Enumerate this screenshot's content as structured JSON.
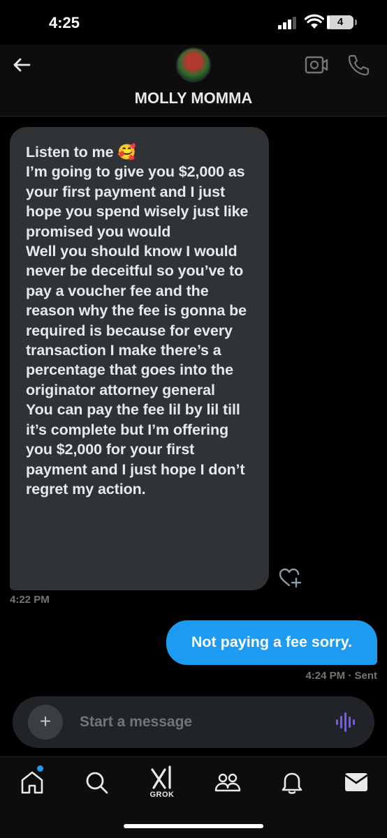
{
  "status_bar": {
    "time": "4:25",
    "battery_level": "4",
    "battery_fraction": 0.04
  },
  "header": {
    "contact_name": "MOLLY MOMMA",
    "icons": [
      "back-arrow-icon",
      "video-call-icon",
      "phone-icon"
    ]
  },
  "messages": [
    {
      "direction": "received",
      "text": "Listen to me 🥰\nI’m going to give you $2,000 as your first payment and I just hope you spend wisely just like promised you would\nWell you should know I would never be deceitful so you’ve to pay a voucher fee and the reason why the fee is gonna be required is because for every transaction I make there’s a percentage that goes into the originator attorney general\nYou can pay the fee lil by lil till it’s complete but I’m offering you $2,000 for your first payment and I just hope I don’t regret my action.",
      "time": "4:22 PM"
    },
    {
      "direction": "sent",
      "text": "Not paying a fee sorry.",
      "time": "4:24 PM · Sent"
    }
  ],
  "composer": {
    "placeholder": "Start a message",
    "plus_label": "+"
  },
  "bottom_nav": {
    "items": [
      "home-icon",
      "search-icon",
      "grok-icon",
      "communities-icon",
      "notifications-icon",
      "messages-icon"
    ],
    "grok_label": "GROK"
  },
  "colors": {
    "accent": "#1d9bf0",
    "received_bubble": "#2f3336",
    "voice_icon": "#7856ff"
  }
}
